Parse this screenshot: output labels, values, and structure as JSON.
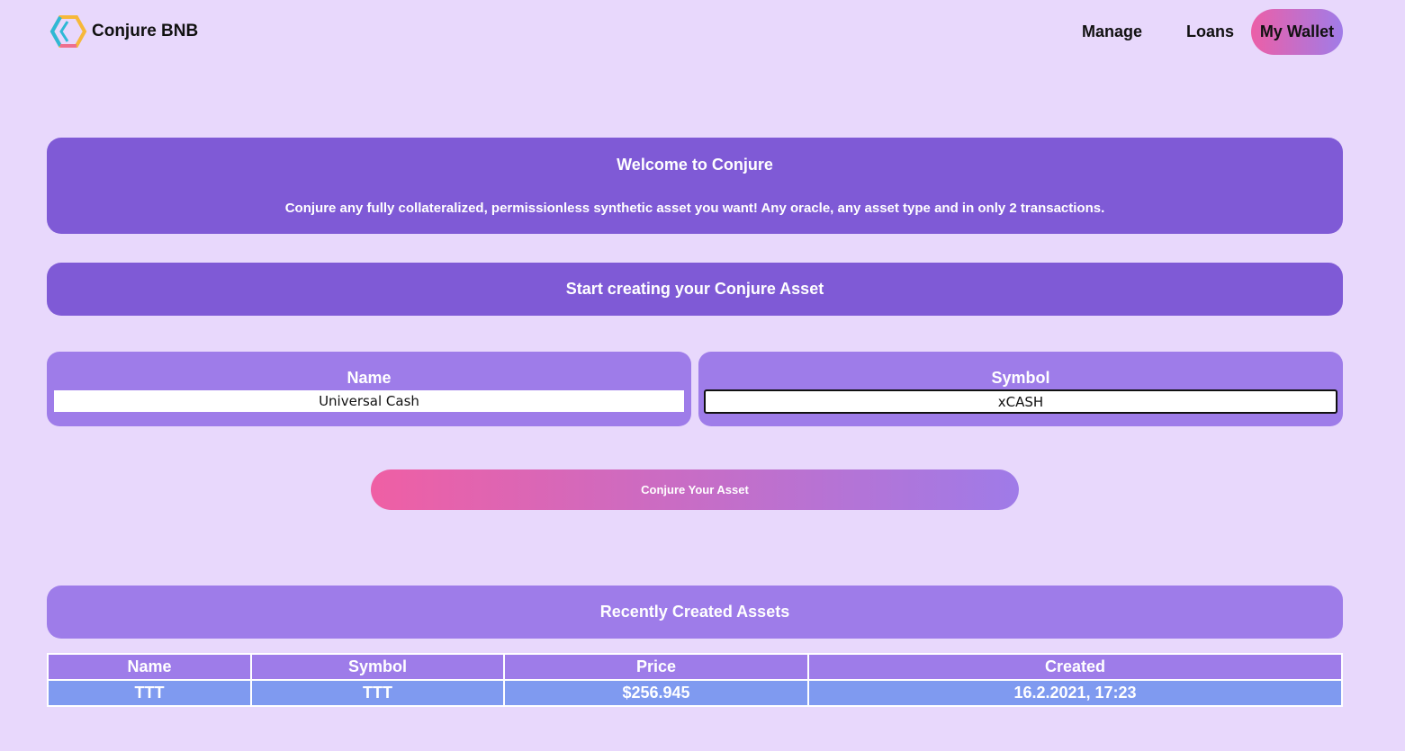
{
  "header": {
    "brand": "Conjure BNB",
    "nav": {
      "manage": "Manage",
      "loans": "Loans",
      "wallet": "My Wallet"
    }
  },
  "welcome": {
    "title": "Welcome to Conjure",
    "text": "Conjure any fully collateralized, permissionless synthetic asset you want! Any oracle, any asset type and in only 2 transactions."
  },
  "start": {
    "title": "Start creating your Conjure Asset"
  },
  "form": {
    "name_label": "Name",
    "name_value": "Universal Cash",
    "symbol_label": "Symbol",
    "symbol_value": "xCASH",
    "submit_label": "Conjure Your Asset"
  },
  "recent": {
    "title": "Recently Created Assets",
    "columns": [
      "Name",
      "Symbol",
      "Price",
      "Created"
    ],
    "rows": [
      [
        "TTT",
        "TTT",
        "$256.945",
        "16.2.2021, 17:23"
      ]
    ]
  },
  "colors": {
    "background": "#e8d8fc",
    "panel_dark": "#7f5ad6",
    "panel_light": "#9e7ce9",
    "row": "#7f9af0",
    "gradient_start": "#ec5fa7",
    "gradient_end": "#a07ce8"
  }
}
